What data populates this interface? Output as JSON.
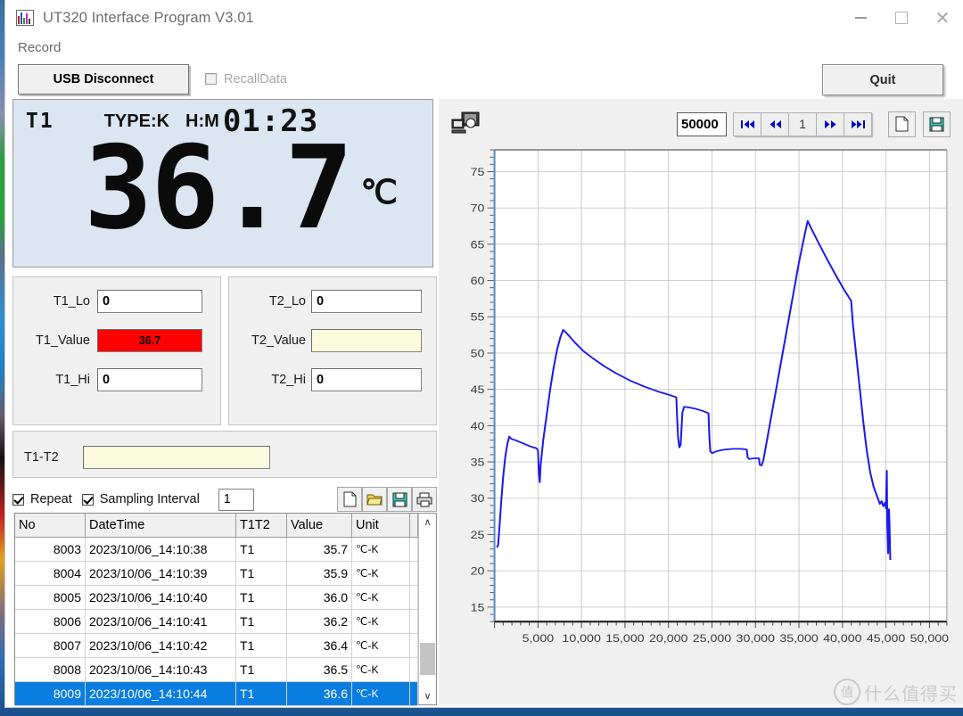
{
  "window": {
    "title": "UT320 Interface Program V3.01",
    "icon": "chart-bars-icon",
    "minimize": "–",
    "maximize": "□",
    "close": "✕"
  },
  "menu": {
    "record": "Record"
  },
  "toolbar": {
    "usb_button": "USB Disconnect",
    "recall_label": "RecallData",
    "recall_checked": false,
    "quit_button": "Quit"
  },
  "lcd": {
    "channel": "T1",
    "type": "TYPE:K",
    "hm_label": "H:M",
    "time": "01:23",
    "value": "36.7",
    "unit": "℃"
  },
  "fields": {
    "t1_lo_label": "T1_Lo",
    "t1_lo_value": "0",
    "t1_value_label": "T1_Value",
    "t1_value_value": "36.7",
    "t1_hi_label": "T1_Hi",
    "t1_hi_value": "0",
    "t2_lo_label": "T2_Lo",
    "t2_lo_value": "0",
    "t2_value_label": "T2_Value",
    "t2_value_value": "",
    "t2_hi_label": "T2_Hi",
    "t2_hi_value": "0",
    "diff_label": "T1-T2",
    "diff_value": "",
    "alarm_color": "#ff0000",
    "readonly_color": "#fbfbdd"
  },
  "sampling": {
    "repeat_label": "Repeat",
    "repeat_checked": true,
    "interval_label": "Sampling Interval",
    "interval_checked": true,
    "interval_value": "1",
    "icons": [
      "new-file-icon",
      "open-folder-icon",
      "save-disk-icon",
      "print-icon"
    ]
  },
  "table": {
    "columns": [
      "No",
      "DateTime",
      "T1T2",
      "Value",
      "Unit"
    ],
    "rows": [
      {
        "no": "8003",
        "datetime": "2023/10/06_14:10:38",
        "t1t2": "T1",
        "value": "35.7",
        "unit": "℃-K",
        "selected": false
      },
      {
        "no": "8004",
        "datetime": "2023/10/06_14:10:39",
        "t1t2": "T1",
        "value": "35.9",
        "unit": "℃-K",
        "selected": false
      },
      {
        "no": "8005",
        "datetime": "2023/10/06_14:10:40",
        "t1t2": "T1",
        "value": "36.0",
        "unit": "℃-K",
        "selected": false
      },
      {
        "no": "8006",
        "datetime": "2023/10/06_14:10:41",
        "t1t2": "T1",
        "value": "36.2",
        "unit": "℃-K",
        "selected": false
      },
      {
        "no": "8007",
        "datetime": "2023/10/06_14:10:42",
        "t1t2": "T1",
        "value": "36.4",
        "unit": "℃-K",
        "selected": false
      },
      {
        "no": "8008",
        "datetime": "2023/10/06_14:10:43",
        "t1t2": "T1",
        "value": "36.5",
        "unit": "℃-K",
        "selected": false
      },
      {
        "no": "8009",
        "datetime": "2023/10/06_14:10:44",
        "t1t2": "T1",
        "value": "36.6",
        "unit": "℃-K",
        "selected": true
      }
    ],
    "scroll_up": "∧",
    "scroll_down": "∨"
  },
  "chart_toolbar": {
    "monitor_icon": "computer-monitor-icon",
    "count_value": "50000",
    "first": "⏮",
    "prev": "◀◀",
    "page": "1",
    "next": "▶▶",
    "last": "⏭",
    "new_icon": "new-file-icon",
    "save_icon": "save-disk-icon"
  },
  "watermark": {
    "logo": "值",
    "text": "什么值得买"
  },
  "chart_data": {
    "type": "line",
    "title": "",
    "xlabel": "",
    "ylabel": "",
    "xlim": [
      0,
      52000
    ],
    "ylim": [
      13,
      78
    ],
    "xticks": [
      5000,
      10000,
      15000,
      20000,
      25000,
      30000,
      35000,
      40000,
      45000,
      50000
    ],
    "xticklabels": [
      "5,000",
      "10,000",
      "15,000",
      "20,000",
      "25,000",
      "30,000",
      "35,000",
      "40,000",
      "45,000",
      "50,000"
    ],
    "yticks": [
      15,
      20,
      25,
      30,
      35,
      40,
      45,
      50,
      55,
      60,
      65,
      70,
      75
    ],
    "grid": true,
    "legend": "none",
    "line_color": "#1a1aee",
    "series": [
      {
        "name": "T1",
        "points": [
          [
            300,
            23.2
          ],
          [
            420,
            23.6
          ],
          [
            600,
            26.5
          ],
          [
            800,
            30.0
          ],
          [
            1000,
            33.0
          ],
          [
            1250,
            35.8
          ],
          [
            1500,
            37.6
          ],
          [
            1700,
            38.5
          ],
          [
            1900,
            38.2
          ],
          [
            2400,
            38.0
          ],
          [
            3000,
            37.7
          ],
          [
            3600,
            37.4
          ],
          [
            4200,
            37.1
          ],
          [
            4800,
            36.9
          ],
          [
            5000,
            36.6
          ],
          [
            5100,
            33.5
          ],
          [
            5200,
            32.2
          ],
          [
            5300,
            34.5
          ],
          [
            5600,
            38.0
          ],
          [
            6000,
            41.5
          ],
          [
            6400,
            45.0
          ],
          [
            6800,
            48.0
          ],
          [
            7200,
            50.5
          ],
          [
            7600,
            52.3
          ],
          [
            7900,
            53.2
          ],
          [
            8400,
            52.6
          ],
          [
            9200,
            51.5
          ],
          [
            10200,
            50.3
          ],
          [
            11400,
            49.2
          ],
          [
            12600,
            48.2
          ],
          [
            14000,
            47.2
          ],
          [
            15600,
            46.2
          ],
          [
            17200,
            45.4
          ],
          [
            18800,
            44.7
          ],
          [
            20200,
            44.2
          ],
          [
            20900,
            43.9
          ],
          [
            21000,
            41.0
          ],
          [
            21100,
            38.4
          ],
          [
            21250,
            37.0
          ],
          [
            21400,
            37.4
          ],
          [
            21600,
            41.8
          ],
          [
            21800,
            42.6
          ],
          [
            22400,
            42.5
          ],
          [
            23200,
            42.3
          ],
          [
            24000,
            42.0
          ],
          [
            24600,
            41.7
          ],
          [
            24700,
            38.5
          ],
          [
            24800,
            36.5
          ],
          [
            25000,
            36.2
          ],
          [
            25600,
            36.5
          ],
          [
            26400,
            36.7
          ],
          [
            27400,
            36.8
          ],
          [
            28400,
            36.8
          ],
          [
            29000,
            36.7
          ],
          [
            29100,
            35.6
          ],
          [
            29300,
            35.4
          ],
          [
            29800,
            35.5
          ],
          [
            30400,
            35.5
          ],
          [
            30500,
            34.6
          ],
          [
            30700,
            34.5
          ],
          [
            30900,
            35.2
          ],
          [
            31400,
            38.5
          ],
          [
            32000,
            42.5
          ],
          [
            32600,
            46.5
          ],
          [
            33200,
            50.5
          ],
          [
            33800,
            54.5
          ],
          [
            34400,
            58.5
          ],
          [
            35000,
            62.5
          ],
          [
            35600,
            66.0
          ],
          [
            36000,
            68.2
          ],
          [
            36400,
            67.2
          ],
          [
            37200,
            65.3
          ],
          [
            38200,
            63.0
          ],
          [
            39200,
            60.8
          ],
          [
            40200,
            58.7
          ],
          [
            41000,
            57.2
          ],
          [
            41200,
            54.0
          ],
          [
            41600,
            49.5
          ],
          [
            42000,
            45.0
          ],
          [
            42400,
            40.5
          ],
          [
            42800,
            36.5
          ],
          [
            43200,
            33.5
          ],
          [
            43600,
            31.5
          ],
          [
            44000,
            30.2
          ],
          [
            44300,
            29.2
          ],
          [
            44500,
            29.6
          ],
          [
            44700,
            28.9
          ],
          [
            44900,
            29.4
          ],
          [
            45000,
            28.6
          ],
          [
            45100,
            33.8
          ],
          [
            45150,
            26.5
          ],
          [
            45200,
            24.5
          ],
          [
            45250,
            22.4
          ],
          [
            45300,
            26.0
          ],
          [
            45350,
            28.5
          ],
          [
            45400,
            26.8
          ],
          [
            45450,
            24.0
          ],
          [
            45500,
            21.5
          ]
        ]
      }
    ]
  }
}
